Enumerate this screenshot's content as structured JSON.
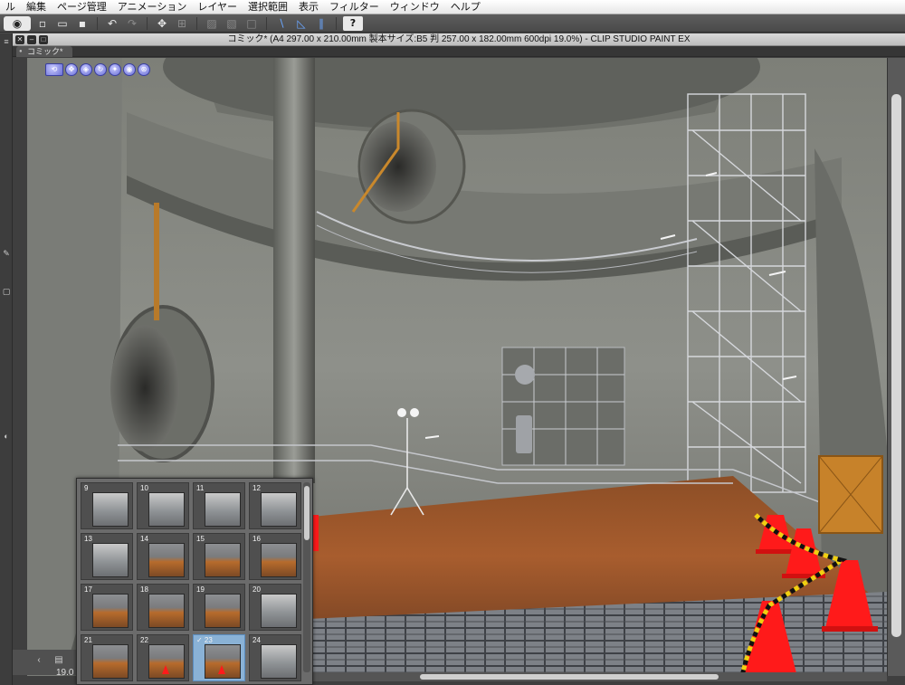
{
  "menubar": {
    "items": [
      "ル",
      "編集",
      "ページ管理",
      "アニメーション",
      "レイヤー",
      "選択範囲",
      "表示",
      "フィルター",
      "ウィンドウ",
      "ヘルプ"
    ]
  },
  "toolbar": {
    "icons": [
      "clip-logo-icon",
      "new-icon",
      "open-icon",
      "save-icon",
      "undo-icon",
      "redo-icon",
      "transform-icon",
      "crop-icon",
      "fill-icon",
      "ruler-icon",
      "snap-ruler-icon",
      "snap-special-ruler-icon",
      "help-icon"
    ],
    "help_label": "?"
  },
  "document": {
    "title": "コミック* (A4 297.00 x 210.00mm 製本サイズ:B5 判 257.00 x 182.00mm 600dpi 19.0%)  - CLIP STUDIO PAINT EX",
    "tab_label": "コミック*"
  },
  "page_manager": {
    "pages": [
      {
        "num": "9",
        "style": "steel"
      },
      {
        "num": "10",
        "style": "steel"
      },
      {
        "num": "11",
        "style": "steel"
      },
      {
        "num": "12",
        "style": "steel"
      },
      {
        "num": "13",
        "style": "steel"
      },
      {
        "num": "14",
        "style": "rust"
      },
      {
        "num": "15",
        "style": "rust"
      },
      {
        "num": "16",
        "style": "rust"
      },
      {
        "num": "17",
        "style": "rust"
      },
      {
        "num": "18",
        "style": "rust"
      },
      {
        "num": "19",
        "style": "rust"
      },
      {
        "num": "20",
        "style": "steel"
      },
      {
        "num": "21",
        "style": "rust"
      },
      {
        "num": "22",
        "style": "cone"
      },
      {
        "num": "✓ 23",
        "style": "cone",
        "selected": true
      },
      {
        "num": "24",
        "style": "steel"
      }
    ]
  },
  "status": {
    "zoom": "19.0"
  },
  "colors": {
    "menubar": "#eeeeee",
    "toolbar": "#555555",
    "canvas_bg": "#8a8c84",
    "floor_rust": "#a0542a",
    "cone_red": "#ff1a1a",
    "selection_blue": "#8ab2d6"
  }
}
